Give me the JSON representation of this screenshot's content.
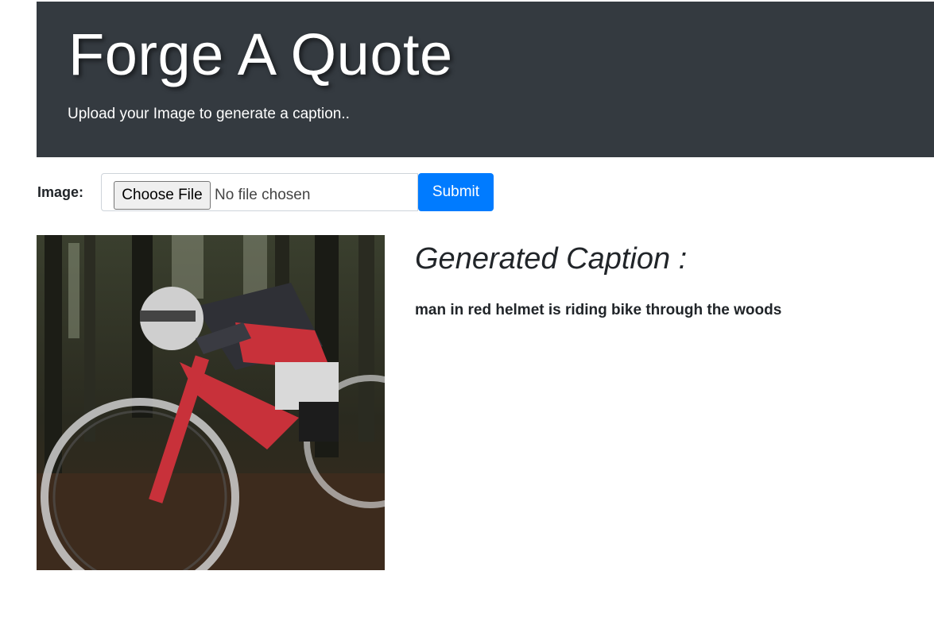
{
  "header": {
    "title": "Forge A Quote",
    "subtitle": "Upload your Image to generate a caption.."
  },
  "form": {
    "label": "Image:",
    "choose_file_label": "Choose File",
    "file_status": "No file chosen",
    "submit_label": "Submit"
  },
  "result": {
    "image_subject": "man riding red mountain bike in forest",
    "heading": "Generated Caption :",
    "caption": "man in red helmet is riding bike through the woods"
  },
  "colors": {
    "header_bg": "#343a40",
    "primary": "#007bff"
  }
}
